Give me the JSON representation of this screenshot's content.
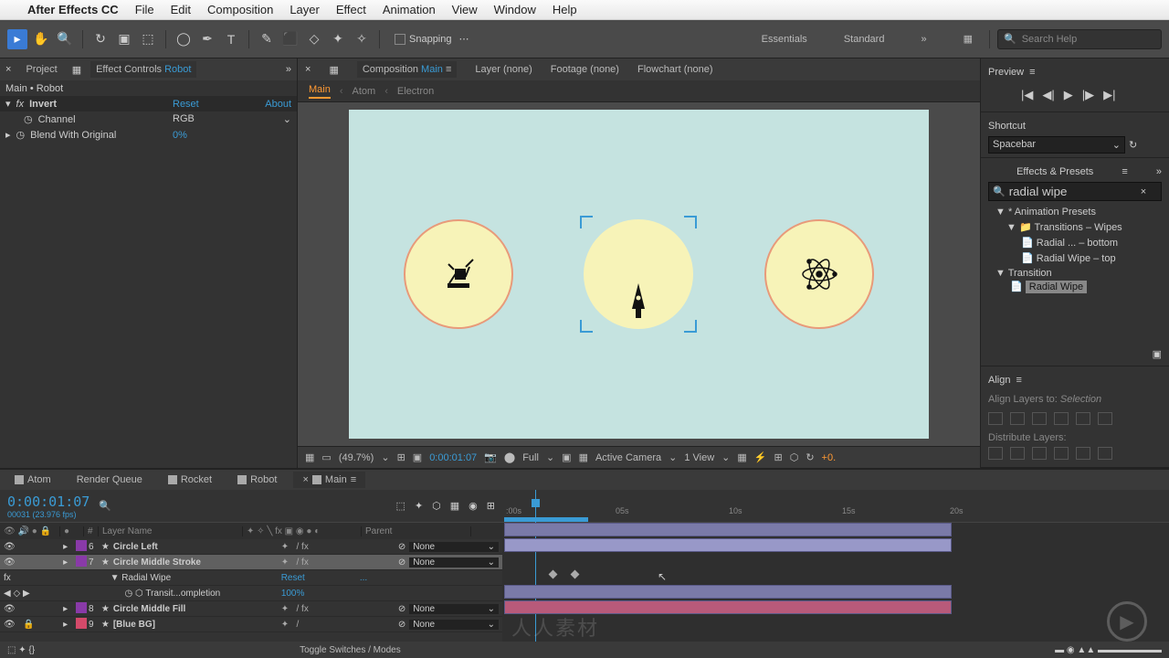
{
  "mac": {
    "app": "After Effects CC",
    "menus": [
      "File",
      "Edit",
      "Composition",
      "Layer",
      "Effect",
      "Animation",
      "View",
      "Window",
      "Help"
    ]
  },
  "toolbar": {
    "snapping": "Snapping",
    "workspaces": [
      "Essentials",
      "Standard"
    ],
    "search_placeholder": "Search Help"
  },
  "left": {
    "tab_project": "Project",
    "tab_effect": "Effect Controls",
    "tab_effect_comp": "Robot",
    "path": "Main • Robot",
    "fx_name": "Invert",
    "reset": "Reset",
    "about": "About",
    "channel_label": "Channel",
    "channel_value": "RGB",
    "blend_label": "Blend With Original",
    "blend_value": "0%"
  },
  "center": {
    "tab_comp": "Composition",
    "tab_comp_name": "Main",
    "tab_layer": "Layer (none)",
    "tab_footage": "Footage (none)",
    "tab_flow": "Flowchart (none)",
    "bc": [
      "Main",
      "Atom",
      "Electron"
    ],
    "zoom": "(49.7%)",
    "time": "0:00:01:07",
    "res": "Full",
    "camera": "Active Camera",
    "view": "1 View",
    "plus": "+0."
  },
  "right": {
    "preview": "Preview",
    "shortcut": "Shortcut",
    "shortcut_val": "Spacebar",
    "effects": "Effects & Presets",
    "search_val": "radial wipe",
    "tree": {
      "presets": "Animation Presets",
      "trans_wipes": "Transitions – Wipes",
      "preset1": "Radial ... – bottom",
      "preset2": "Radial Wipe – top",
      "transition": "Transition",
      "radial": "Radial Wipe"
    },
    "align": "Align",
    "align_to": "Align Layers to:",
    "align_val": "Selection",
    "distribute": "Distribute Layers:"
  },
  "timeline": {
    "tabs": [
      "Atom",
      "Render Queue",
      "Rocket",
      "Robot",
      "Main"
    ],
    "timecode": "0:00:01:07",
    "fps": "00031 (23.976 fps)",
    "col_layer": "Layer Name",
    "col_parent": "Parent",
    "layers": [
      {
        "n": "6",
        "name": "Circle Left",
        "parent": "None",
        "color": "#893aa8"
      },
      {
        "n": "7",
        "name": "Circle Middle Stroke",
        "parent": "None",
        "color": "#893aa8",
        "sel": true
      },
      {
        "n": "",
        "name": "Radial Wipe",
        "parent": "",
        "reset": "Reset",
        "sub": true
      },
      {
        "n": "",
        "name": "Transit...ompletion",
        "parent": "",
        "val": "100%",
        "sub": true,
        "kf": true
      },
      {
        "n": "8",
        "name": "Circle Middle Fill",
        "parent": "None",
        "color": "#893aa8"
      },
      {
        "n": "9",
        "name": "[Blue BG]",
        "parent": "None",
        "color": "#d44a6a"
      }
    ],
    "ticks": [
      ":00s",
      "05s",
      "10s",
      "15s",
      "20s"
    ],
    "toggle": "Toggle Switches / Modes"
  }
}
